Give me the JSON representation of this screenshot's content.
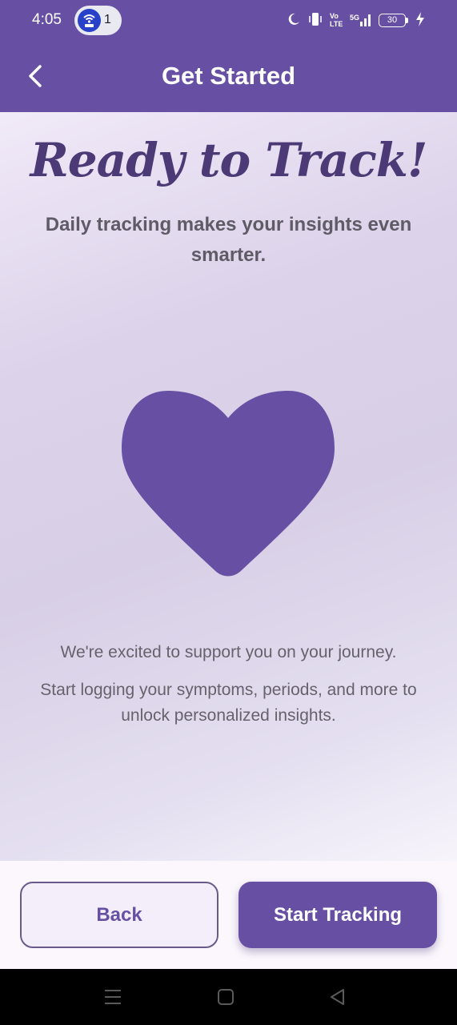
{
  "status_bar": {
    "time": "4:05",
    "notification_count": "1",
    "network": "Vo LTE",
    "signal": "5G",
    "battery": "30"
  },
  "app_bar": {
    "title": "Get Started"
  },
  "main": {
    "headline": "Ready to Track!",
    "subtitle": "Daily tracking makes your insights even smarter.",
    "body_line_1": "We're excited to support you on your journey.",
    "body_line_2": "Start logging your symptoms, periods, and more to unlock personalized insights."
  },
  "actions": {
    "back_label": "Back",
    "start_label": "Start Tracking"
  },
  "icons": {
    "heart": "heart-icon",
    "back": "back-arrow-icon",
    "nav_menu": "menu-icon",
    "nav_home": "home-icon",
    "nav_back": "triangle-back-icon"
  },
  "colors": {
    "primary": "#6750a4",
    "headline": "#4b3a75",
    "heart": "#6750a4"
  }
}
